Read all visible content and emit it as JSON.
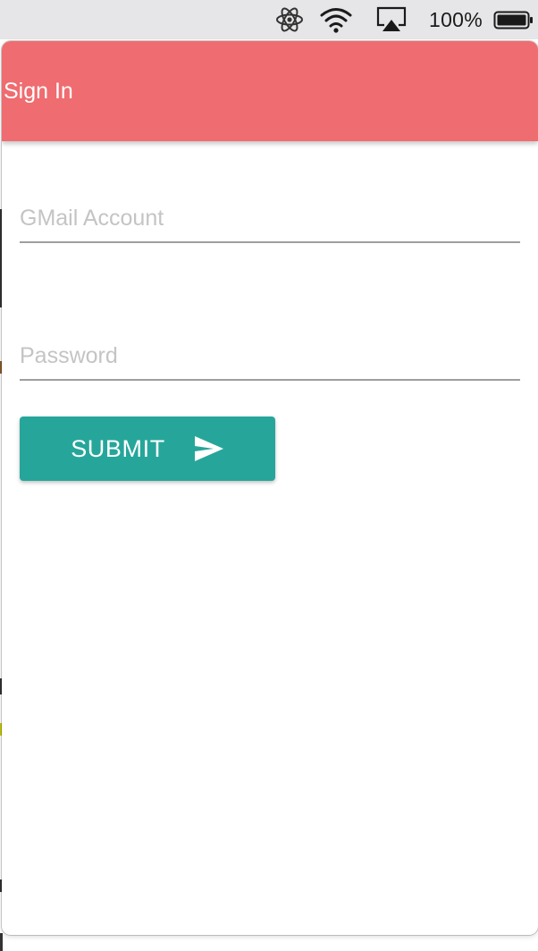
{
  "menubar": {
    "icons": [
      "electron-atom-icon",
      "wifi-icon",
      "airplay-icon",
      "battery-icon"
    ],
    "battery_percent": "100%"
  },
  "window": {
    "title": "Sign In",
    "accent_color": "#ef6c70"
  },
  "form": {
    "gmail": {
      "placeholder": "GMail Account",
      "value": ""
    },
    "password": {
      "placeholder": "Password",
      "value": ""
    },
    "submit": {
      "label": "SUBMIT",
      "icon": "send-icon",
      "color": "#26a69a"
    }
  }
}
